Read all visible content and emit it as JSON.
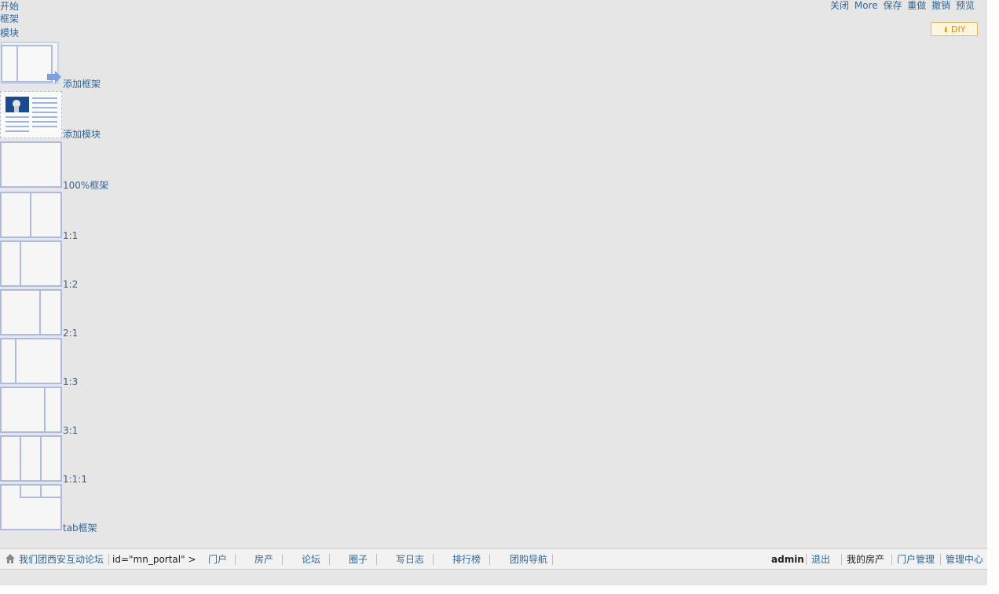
{
  "menu_stack": [
    "开始",
    "框架",
    "模块"
  ],
  "top_controls": [
    "关闭",
    "More",
    "保存",
    "重做",
    "撤销",
    "预览"
  ],
  "diy_button": "DIY",
  "palette": [
    {
      "label": "添加框架",
      "icon": "add-frame-icon"
    },
    {
      "label": "添加模块",
      "icon": "add-module-icon"
    },
    {
      "label": "100%框架",
      "icon": "frame-100-icon"
    },
    {
      "label": "1:1",
      "icon": "frame-1-1-icon"
    },
    {
      "label": "1:2",
      "icon": "frame-1-2-icon"
    },
    {
      "label": "2:1",
      "icon": "frame-2-1-icon"
    },
    {
      "label": "1:3",
      "icon": "frame-1-3-icon"
    },
    {
      "label": "3:1",
      "icon": "frame-3-1-icon"
    },
    {
      "label": "1:1:1",
      "icon": "frame-1-1-1-icon"
    },
    {
      "label": "tab框架",
      "icon": "tab-frame-icon"
    }
  ],
  "footer": {
    "site": "我们团西安互动论坛",
    "breadcrumb": "id=\"mn_portal\" >",
    "nav": [
      "门户",
      "房产",
      "论坛",
      "圈子",
      "写日志",
      "排行榜",
      "团购导航"
    ],
    "user": "admin",
    "logout": "退出",
    "right_links": [
      "我的房产",
      "门户管理",
      "管理中心"
    ]
  }
}
